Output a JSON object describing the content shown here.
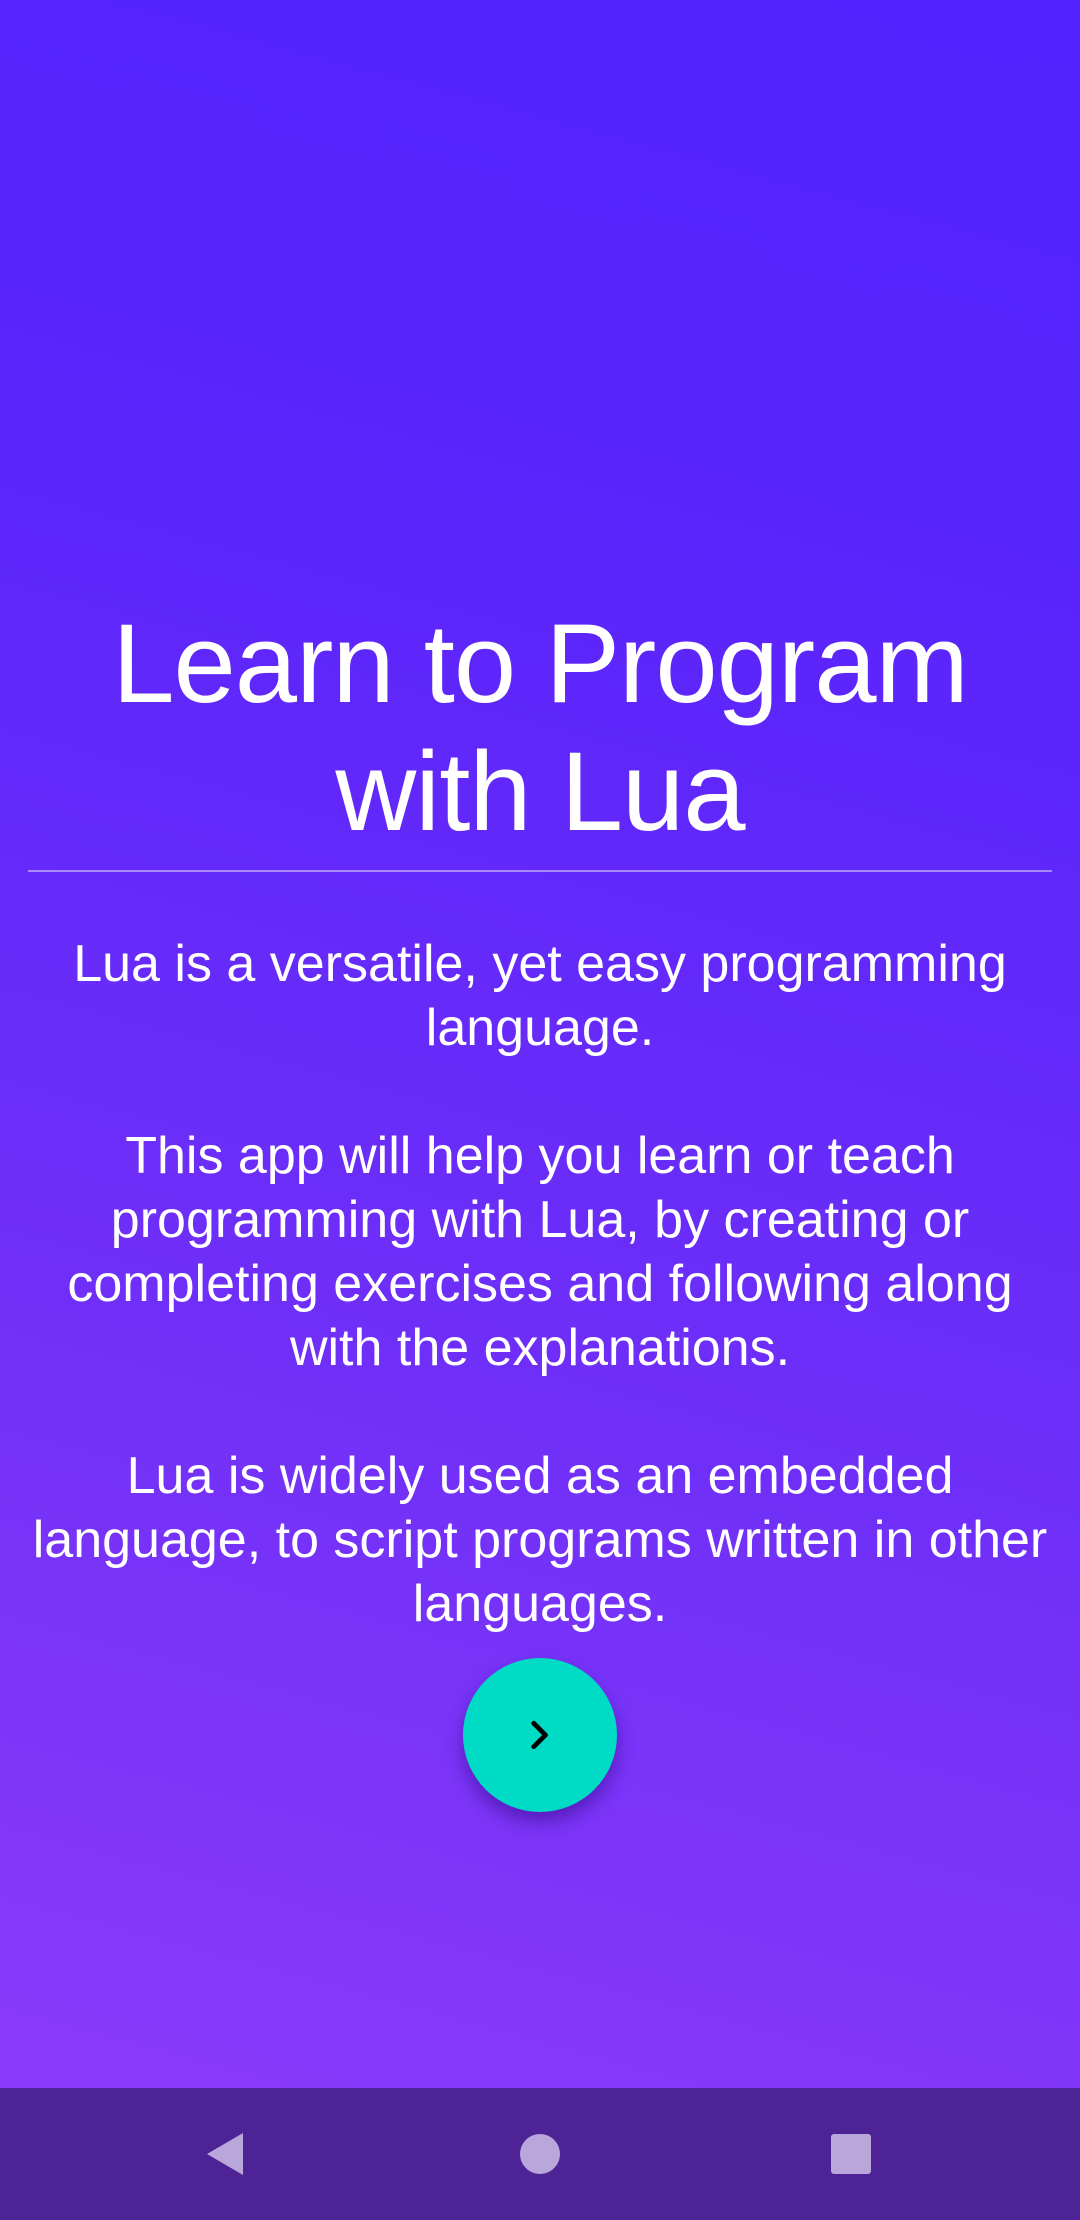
{
  "onboarding": {
    "title": "Learn to Program\nwith Lua",
    "paragraphs": [
      "Lua is a versatile, yet easy programming language.",
      "This app will help you learn or teach programming with Lua, by creating or completing exercises and following along with the explanations.",
      "Lua is widely used as an embedded language, to script programs written in other languages."
    ],
    "next_icon": "chevron-right-icon"
  },
  "navbar": {
    "back_icon": "back-triangle-icon",
    "home_icon": "home-circle-icon",
    "recents_icon": "recents-square-icon"
  },
  "colors": {
    "gradient_top": "#4f22ff",
    "gradient_bottom": "#8a3afa",
    "accent": "#00dbc6",
    "navbar": "#4d2396"
  }
}
